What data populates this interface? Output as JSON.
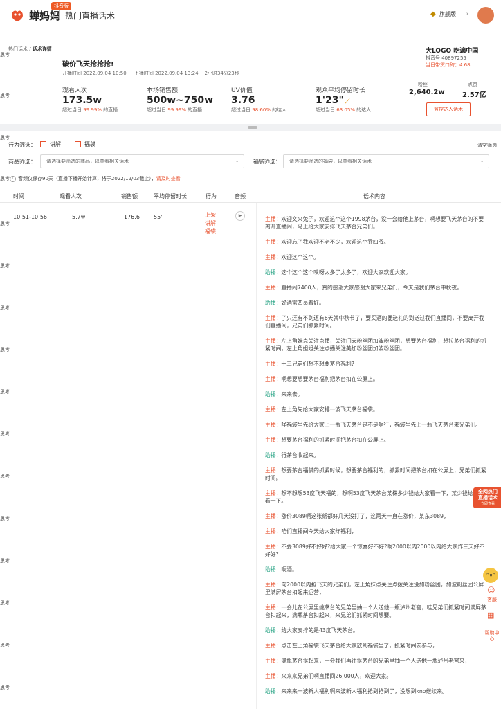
{
  "topbar": {
    "brand": "蝉妈妈",
    "badge": "抖音版",
    "section_title": "热门直播话术",
    "vip_label": "旗舰版",
    "vip_icon": "diamond-icon",
    "avatar_caret": "›"
  },
  "watermark": "思考",
  "breadcrumb": {
    "parent": "热门话术",
    "sep": " / ",
    "current": "话术详情"
  },
  "live": {
    "title": "破价飞天抢抢抢!",
    "start_label": "开播时间",
    "start_time": "2022.09.04 10:50",
    "end_label": "下播时间",
    "end_time": "2022.09.04 13:24",
    "duration": "2小时34分23秒"
  },
  "stats": [
    {
      "label": "观看人次",
      "value": "173.5w",
      "cmp_prefix": "超过当日",
      "cmp_pct": "99.99%",
      "cmp_suffix": "的直播"
    },
    {
      "label": "本场销售额",
      "value": "500w~750w",
      "cmp_prefix": "超过当日",
      "cmp_pct": "99.99%",
      "cmp_suffix": "的直播"
    },
    {
      "label": "UV价值",
      "value": "3.76",
      "cmp_prefix": "超过当日",
      "cmp_pct": "98.60%",
      "cmp_suffix": "的达人"
    },
    {
      "label": "观众平均停留时长",
      "value": "1'23\"",
      "cmp_prefix": "超过当日",
      "cmp_pct": "63.05%",
      "cmp_suffix": "的达人"
    }
  ],
  "shop": {
    "name": "大LOGO 吃遍中国",
    "douyin_id": "抖音号 40897255",
    "score": "当日带货口碑：4.68",
    "fans_label": "粉丝",
    "fans_value": "2,640.2w",
    "likes_label": "点赞",
    "likes_value": "2.57亿",
    "monitor_button": "监控达人话术"
  },
  "filters": {
    "behavior_label": "行为筛选：",
    "options": [
      "讲解",
      "福袋"
    ],
    "clear": "清空筛选",
    "product_label": "商品筛选：",
    "product_placeholder": "请选择要筛选的商品，以查看相关话术",
    "bag_label": "福袋筛选：",
    "bag_placeholder": "请选择要筛选的福袋，以查看相关话术",
    "caret": "⌄"
  },
  "info": {
    "text": "音频仅保存90天（直播下播开始计算，将于2022/12/03截止），",
    "link": "请及时查看"
  },
  "table": {
    "headers": [
      "时间",
      "观看人次",
      "销售额",
      "平均停留时长",
      "行为",
      "音频",
      "话术内容"
    ],
    "row": {
      "time": "10:51-10:56",
      "views": "5.7w",
      "sales": "176.6",
      "stay": "55''",
      "behaviors": [
        "上架",
        "讲解",
        "福袋"
      ],
      "audio_icon": "▶"
    }
  },
  "script_lines": [
    {
      "speaker": "主播：",
      "role": "host",
      "text": "欢迎文来兔子，欢迎这个这个1998茅台，没一会给他上茅台，啊想要飞天茅台的不要离开直播间，马上给大家安排飞天茅台兄弟们。"
    },
    {
      "speaker": "主播：",
      "role": "host",
      "text": "欢迎忘了我欢迎不老不少，欢迎这个乔四爷。"
    },
    {
      "speaker": "主播：",
      "role": "host",
      "text": "欢迎这个这个。"
    },
    {
      "speaker": "助播：",
      "role": "asst",
      "text": "这个这个这个嗅呀太多了太多了，欢迎大家欢迎大家。"
    },
    {
      "speaker": "主播：",
      "role": "host",
      "text": "直播间7400人，真的感谢大家感谢大家来兄弟们，今天是我们茅台中秋夜。"
    },
    {
      "speaker": "助播：",
      "role": "asst",
      "text": "好酒需四员着好。"
    },
    {
      "speaker": "主播：",
      "role": "host",
      "text": "了只还有不到还有6天就中秋节了，要买酒的要送礼的到送过我们直播间，不要离开我们直播间，兄弟们抓紧时间。"
    },
    {
      "speaker": "主播：",
      "role": "host",
      "text": "左上角妹点关注点播，关注门天粉丝团加波粉丝团，想要茅台福利，想拉茅台福利的抓紧时间，左上角姐姐关注点播关注美加粉丝团加波粉丝团。"
    },
    {
      "speaker": "主播：",
      "role": "host",
      "text": "十三兄弟们想不想要茅台福利?"
    },
    {
      "speaker": "主播：",
      "role": "host",
      "text": "啊想要想要茅台福利把茅台扣在公屏上。"
    },
    {
      "speaker": "助播：",
      "role": "asst",
      "text": "来来去。"
    },
    {
      "speaker": "主播：",
      "role": "host",
      "text": "左上角先给大家安排一波飞天茅台福袋。"
    },
    {
      "speaker": "主播：",
      "role": "host",
      "text": "咩福袋里先给大家上一瓶飞天茅台是不是啊行，福袋里先上一瓶飞天茅台来兄弟们。"
    },
    {
      "speaker": "主播：",
      "role": "host",
      "text": "想要茅台福利的抓紧时间把茅台扣在公屏上。"
    },
    {
      "speaker": "助播：",
      "role": "asst",
      "text": "行茅台收起来。"
    },
    {
      "speaker": "主播：",
      "role": "host",
      "text": "想要茅台福袋的抓紧时候，想要茅台福利的，抓紧时间把茅台扣在公屏上，兄弟们抓紧时间。"
    },
    {
      "speaker": "主播：",
      "role": "host",
      "text": "想不想想53度飞天福的，想啊53度飞天茅台某株多少钱给大家看一下，某少钱给大家看一下。"
    },
    {
      "speaker": "主播：",
      "role": "host",
      "text": "涨价3089啊这张纸都好几天没打了，这两天一直在涨价，某东3089，"
    },
    {
      "speaker": "主播：",
      "role": "host",
      "text": "咱们直播间今天给大家炸福利，"
    },
    {
      "speaker": "主播：",
      "role": "host",
      "text": "不要3089好不好好?给大家一个惊喜好不好?啊2000以内2000以内给大家炸三天好不好好?"
    },
    {
      "speaker": "助播：",
      "role": "asst",
      "text": "啊酒。"
    },
    {
      "speaker": "主播：",
      "role": "host",
      "text": "向2000以内抢飞天的兄弟们，左上角妹点关注点拨关注没加粉丝团，加波粉丝团公屏里满屏茅台扣起来运营，"
    },
    {
      "speaker": "主播：",
      "role": "host",
      "text": "一会儿在公屏里挑茅台的兄弟里抽一个人送他一瓶泸州老窖，哇兄弟们抓紧时间满屏茅台扣起来，满瓶茅台扣起来，来兄弟们抓紧时间想要。"
    },
    {
      "speaker": "助播：",
      "role": "asst",
      "text": "给大家安排的是43度飞天茅台。"
    },
    {
      "speaker": "主播：",
      "role": "host",
      "text": "点击左上角福袋飞天茅台给大家放到福袋里了，抓紧时间去参与，"
    },
    {
      "speaker": "主播：",
      "role": "host",
      "text": "满瓶茅台抠起来，一会我们再往抠茅台的兄弟里抽一个人送他一瓶泸州老窖来，"
    },
    {
      "speaker": "主播：",
      "role": "host",
      "text": "来来来兄弟们啊直播间26,000人，欢迎大家。"
    },
    {
      "speaker": "助播：",
      "role": "asst",
      "text": "来来来一波新人福利啊来波新人福利抢到抢到了，没想到kno继续来。"
    }
  ],
  "float_badge": {
    "line1": "全网热门",
    "line2": "直播话术",
    "line3": "立即查看"
  },
  "side_tools": [
    "客服",
    "帮助中心"
  ],
  "colors": {
    "accent": "#e8522f",
    "assistant": "#20a080"
  }
}
